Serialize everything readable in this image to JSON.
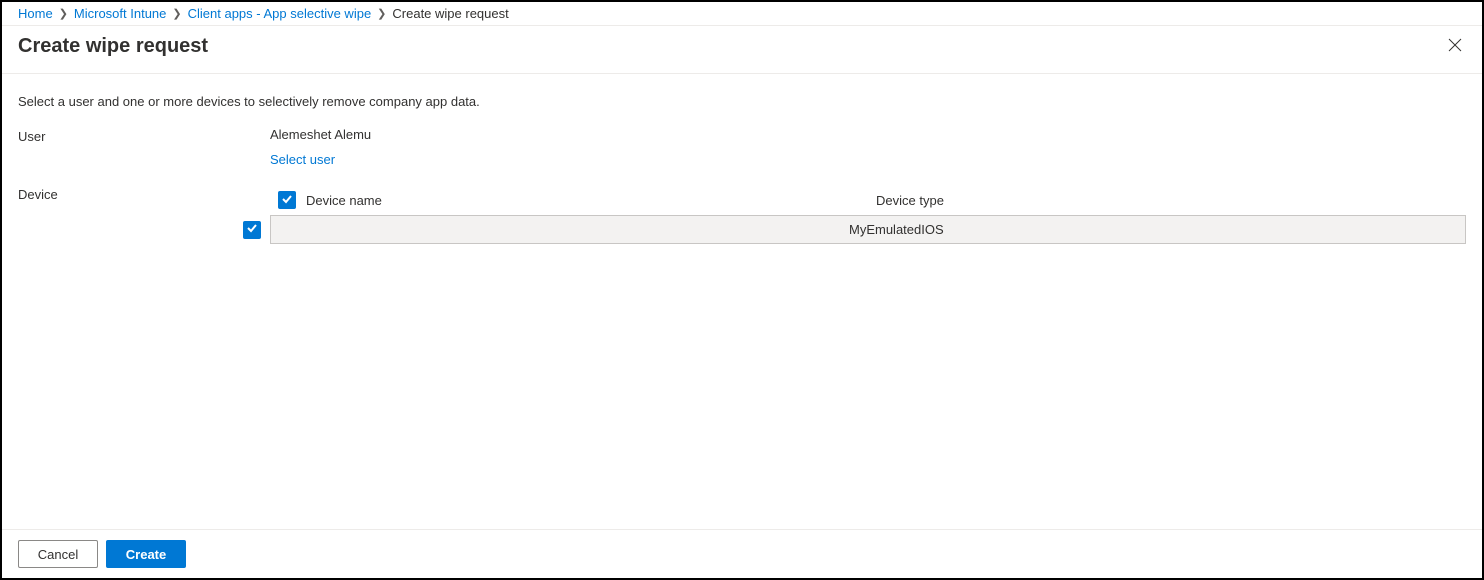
{
  "breadcrumb": {
    "items": [
      {
        "label": "Home",
        "link": true
      },
      {
        "label": "Microsoft Intune",
        "link": true
      },
      {
        "label": "Client apps - App selective wipe",
        "link": true
      },
      {
        "label": "Create wipe request",
        "link": false
      }
    ]
  },
  "header": {
    "title": "Create wipe request"
  },
  "content": {
    "description": "Select a user and one or more devices to selectively remove company app data.",
    "user_label": "User",
    "user_name": "Alemeshet Alemu",
    "select_user_link": "Select user",
    "device_label": "Device",
    "table": {
      "header_name": "Device name",
      "header_type": "Device type",
      "rows": [
        {
          "name": "",
          "type": "MyEmulatedIOS",
          "checked": true
        }
      ]
    }
  },
  "footer": {
    "cancel": "Cancel",
    "create": "Create"
  }
}
